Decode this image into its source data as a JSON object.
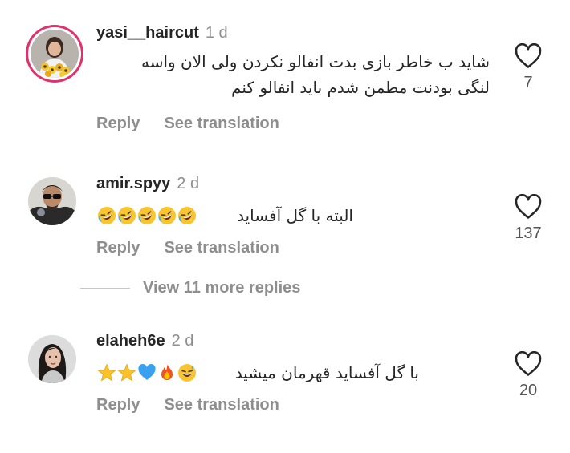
{
  "comments": [
    {
      "username": "yasi__haircut",
      "time": "1 d",
      "text_lines": [
        "شاید ب خاطر بازی بدت انفالو نکردن ولی الان واسه",
        "لنگی بودنت مطمن شدم باید انفالو کنم"
      ],
      "emoji": [],
      "likes": "7",
      "reply_label": "Reply",
      "translate_label": "See translation",
      "avatar_icon": "woman-with-flowers-avatar",
      "has_story_ring": true
    },
    {
      "username": "amir.spyy",
      "time": "2 d",
      "text_lines": [
        "البته با گل آفساید"
      ],
      "emoji": [
        "rofl",
        "rofl",
        "rofl",
        "rofl",
        "rofl"
      ],
      "likes": "137",
      "reply_label": "Reply",
      "translate_label": "See translation",
      "avatar_icon": "man-with-sunglasses-avatar",
      "has_story_ring": false
    },
    {
      "username": "elaheh6e",
      "time": "2 d",
      "text_lines": [
        "با گل آفساید قهرمان میشید"
      ],
      "emoji": [
        "grin-sweat",
        "fire",
        "blue-heart",
        "star",
        "star"
      ],
      "likes": "20",
      "reply_label": "Reply",
      "translate_label": "See translation",
      "avatar_icon": "woman-portrait-avatar",
      "has_story_ring": false
    }
  ],
  "view_replies_label": "View 11 more replies",
  "colors": {
    "text": "#262626",
    "muted": "#8e8e8e",
    "ring": "#e1306c",
    "divider": "#c7c7c7"
  }
}
